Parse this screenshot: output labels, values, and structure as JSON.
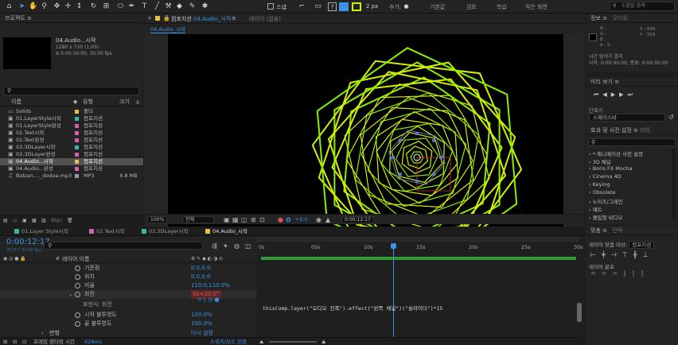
{
  "toolbar": {
    "snap_label": "스냅",
    "zoom_value": "2 px",
    "add_label": "추가:",
    "workspaces": [
      "기본값",
      "검토",
      "학습",
      "작은 화면"
    ],
    "search_placeholder": "도움말 검색"
  },
  "project": {
    "title": "프로젝트",
    "selected_name": "04.Audio...시작",
    "selected_dims": "1280 x 720 (1.00)",
    "selected_duration": "Δ 0:00:30:00, 30.00 fps",
    "columns": {
      "name": "이름",
      "type": "유형",
      "size": "크기"
    },
    "items": [
      {
        "name": "Solids",
        "label_color": "#e8c04a",
        "type": "폴더",
        "size": "",
        "icon": "folder-icon"
      },
      {
        "name": "01.LayerStyle시작",
        "label_color": "#3bb3a8",
        "type": "컴포지션",
        "size": "",
        "icon": "composition-icon"
      },
      {
        "name": "01.LayerStyle완성",
        "label_color": "#d060b0",
        "type": "컴포지션",
        "size": "",
        "icon": "composition-icon"
      },
      {
        "name": "02.Text시작",
        "label_color": "#d060b0",
        "type": "컴포지션",
        "size": "",
        "icon": "composition-icon"
      },
      {
        "name": "02.Text완성",
        "label_color": "#d060b0",
        "type": "컴포지션",
        "size": "",
        "icon": "composition-icon"
      },
      {
        "name": "03.3DLayer시작",
        "label_color": "#3bb3a8",
        "type": "컴포지션",
        "size": "",
        "icon": "composition-icon"
      },
      {
        "name": "03.3DLayer완성",
        "label_color": "#d060b0",
        "type": "컴포지션",
        "size": "",
        "icon": "composition-icon"
      },
      {
        "name": "04.Audio...시작",
        "label_color": "#e8c04a",
        "type": "컴포지션",
        "size": "",
        "icon": "composition-icon",
        "selected": true
      },
      {
        "name": "04.Audio...완성",
        "label_color": "#d060b0",
        "type": "컴포지션",
        "size": "",
        "icon": "composition-icon"
      },
      {
        "name": "Balzan...._dodaa.mp3",
        "label_color": "#9a9a9a",
        "type": "MP3",
        "size": "4.8 MB",
        "icon": "audio-file-icon"
      }
    ],
    "bit_depth": "8bpc"
  },
  "viewer": {
    "tab_label": "컴포지션",
    "tab_comp": "04.Audio_시작",
    "layer_tab": "레이어 (없음)",
    "breadcrumb": "04.Audio_시작",
    "zoom": "100%",
    "resolution": "전체",
    "exposure": "+0.0",
    "timecode": "0:00:12:17"
  },
  "info": {
    "title": "정보",
    "audio_tab": "오디오",
    "rgb": [
      "R :",
      "G :",
      "B :",
      "A : 0"
    ],
    "x": "X : 640",
    "y": "Y : 359",
    "comp_line1": "시간 탐색기 결과",
    "comp_line2": "시작: 0:00:00:00, 종료: 0:00:30:00"
  },
  "preview": {
    "title": "미리 보기"
  },
  "shortcut": {
    "label": "단축키",
    "value": "스페이스바"
  },
  "effects": {
    "title": "효과 및 사전 설정",
    "tab2": "라이",
    "items": [
      "* 애니메이션 사전 설정",
      "3D 채널",
      "Boris FX Mocha",
      "Cinema 4D",
      "Keying",
      "Obsolete",
      "노이즈/그레인",
      "매트",
      "몰입형 비디오"
    ]
  },
  "align": {
    "title": "맞춤",
    "tab2": "단락",
    "align_to_label": "레이어 맞춤 대상:",
    "align_to_value": "컴포지션",
    "distribute_label": "레이어 분포"
  },
  "timeline": {
    "tabs": [
      {
        "label": "01.Layer Style시작",
        "color": "#3bb3a8"
      },
      {
        "label": "02.Text시작",
        "color": "#d060b0"
      },
      {
        "label": "03.3DLayer시작",
        "color": "#3bb3a8"
      },
      {
        "label": "04.Audio_시작",
        "color": "#e8c04a",
        "active": true
      }
    ],
    "timecode": "0:00:12:17",
    "frame_info": "00377 (30.00 fps)",
    "layer_header": "레이어 이름",
    "rows": [
      {
        "name": "기준점",
        "value": "0.0,0.0"
      },
      {
        "name": "위치",
        "value": "0.0,0.0"
      },
      {
        "name": "비율",
        "value": "110.0,110.0%"
      },
      {
        "name": "회전",
        "value": "0x+20.8°",
        "selected": true
      },
      {
        "name": "표현식: 회전",
        "value": ""
      },
      {
        "name": "시작 불투명도",
        "value": "100.0%"
      },
      {
        "name": "끝 불투명도",
        "value": "100.0%"
      },
      {
        "name": "변형",
        "value": "다시 설정"
      }
    ],
    "ruler": [
      "0s",
      "05s",
      "10s",
      "15s",
      "20s",
      "25s",
      "30s"
    ],
    "playhead_seconds": 12.57,
    "duration_seconds": 30,
    "expression": "thisComp.layer(\"오디오 진폭\").effect(\"왼쪽 채널\")(\"슬라이더\")*15",
    "render_time_label": "프레임 렌더링 시간",
    "render_time_value": "628ms",
    "toggle_label": "스위치/모드 전환"
  },
  "colors": {
    "accent": "#3b93e8",
    "shape": "#d4f000",
    "lime": "#8bf000"
  }
}
